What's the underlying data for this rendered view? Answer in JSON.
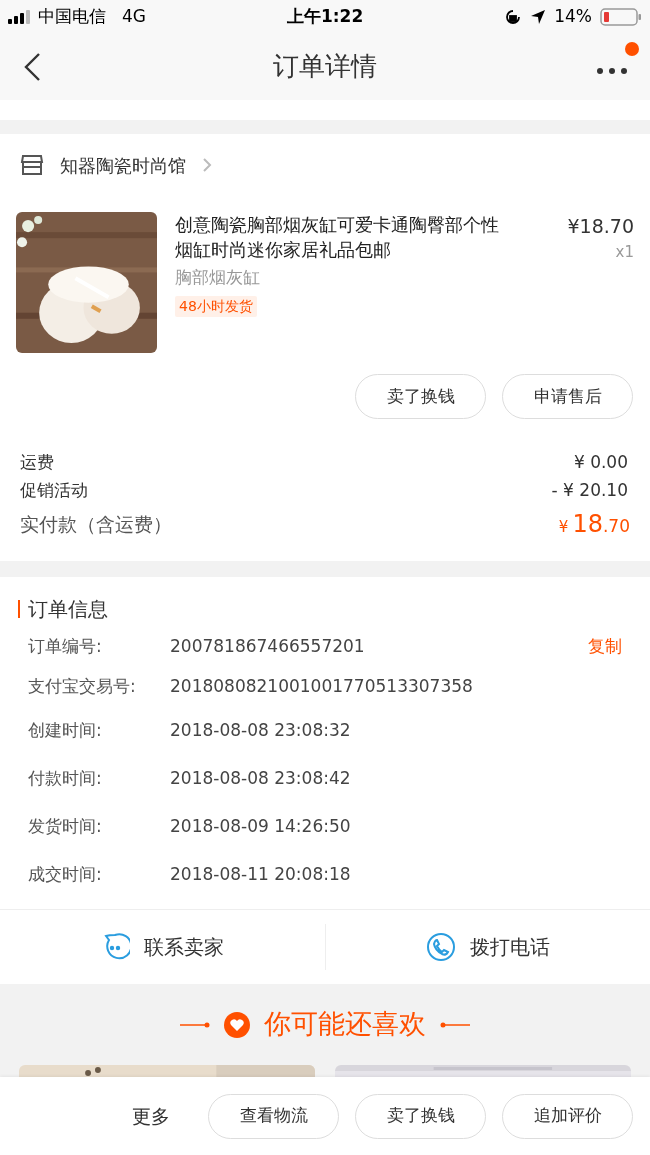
{
  "status_bar": {
    "carrier": "中国电信",
    "network": "4G",
    "time": "上午1:22",
    "battery": "14%"
  },
  "nav": {
    "title": "订单详情",
    "has_badge": true
  },
  "shop": {
    "name": "知器陶瓷时尚馆"
  },
  "product": {
    "title": "创意陶瓷胸部烟灰缸可爱卡通陶臀部个性烟缸时尚迷你家居礼品包邮",
    "variant": "胸部烟灰缸",
    "tag": "48小时发货",
    "price": "¥18.70",
    "quantity": "x1"
  },
  "product_actions": [
    "卖了换钱",
    "申请售后"
  ],
  "fees": [
    {
      "label": "运费",
      "value": "¥ 0.00"
    },
    {
      "label": "促销活动",
      "value": "- ¥ 20.10"
    }
  ],
  "total": {
    "label": "实付款（含运费）",
    "currency": "¥",
    "integer": "18",
    "decimal": ".70"
  },
  "order_info": {
    "title": "订单信息",
    "rows": [
      {
        "label": "订单编号:",
        "value": "200781867466557201",
        "action": "复制"
      },
      {
        "label": "支付宝交易号:",
        "value": "2018080821001001770513307358"
      },
      {
        "label": "创建时间:",
        "value": "2018-08-08 23:08:32"
      },
      {
        "label": "付款时间:",
        "value": "2018-08-08 23:08:42"
      },
      {
        "label": "发货时间:",
        "value": "2018-08-09 14:26:50"
      },
      {
        "label": "成交时间:",
        "value": "2018-08-11 20:08:18"
      }
    ]
  },
  "contacts": [
    {
      "kind": "chat",
      "label": "联系卖家"
    },
    {
      "kind": "phone",
      "label": "拨打电话"
    }
  ],
  "recommend": {
    "title": "你可能还喜欢"
  },
  "bottom_bar": {
    "more": "更多",
    "buttons": [
      "查看物流",
      "卖了换钱",
      "追加评价"
    ]
  }
}
